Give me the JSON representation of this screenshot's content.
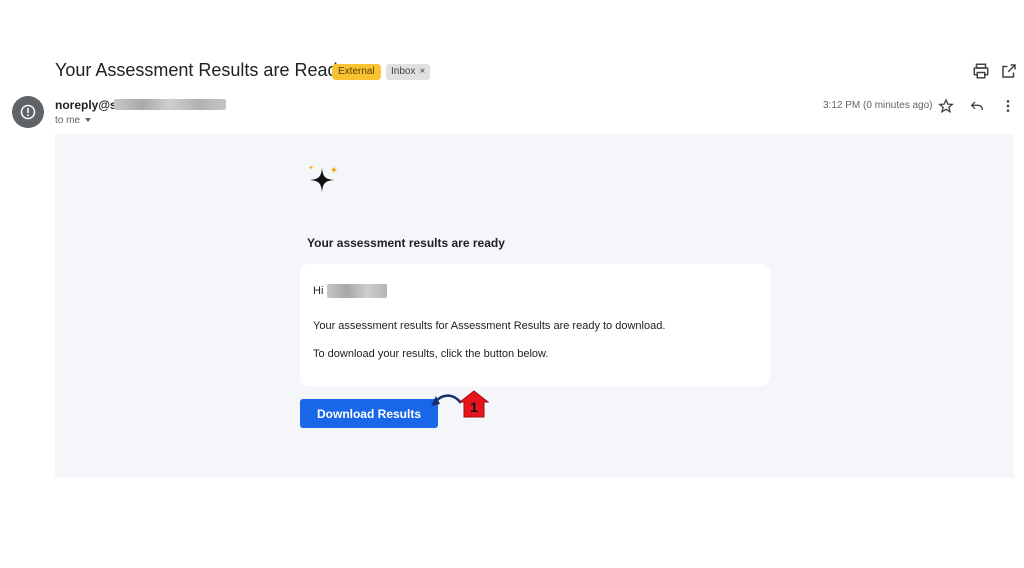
{
  "email": {
    "subject": "Your Assessment Results are Ready",
    "labels": {
      "external": "External",
      "inbox": "Inbox"
    },
    "sender_prefix": "noreply@s",
    "recipient": "to me",
    "timestamp": "3:12 PM (0 minutes ago)"
  },
  "body": {
    "heading": "Your assessment results are ready",
    "greeting": "Hi",
    "line1": "Your assessment results for Assessment Results are ready to download.",
    "line2": "To download your results, click the button below.",
    "button_label": "Download Results"
  },
  "annotation": {
    "number": "1",
    "color": "#e8141c"
  },
  "colors": {
    "accent": "#1a66e8",
    "external_tag": "#f8c233",
    "body_bg": "#f4f6fa"
  },
  "icons": [
    "alert-icon",
    "print-icon",
    "open-new-window-icon",
    "star-icon",
    "reply-icon",
    "more-vert-icon",
    "sparkle-icon",
    "x-icon",
    "caret-down-icon",
    "arrow-icon"
  ]
}
